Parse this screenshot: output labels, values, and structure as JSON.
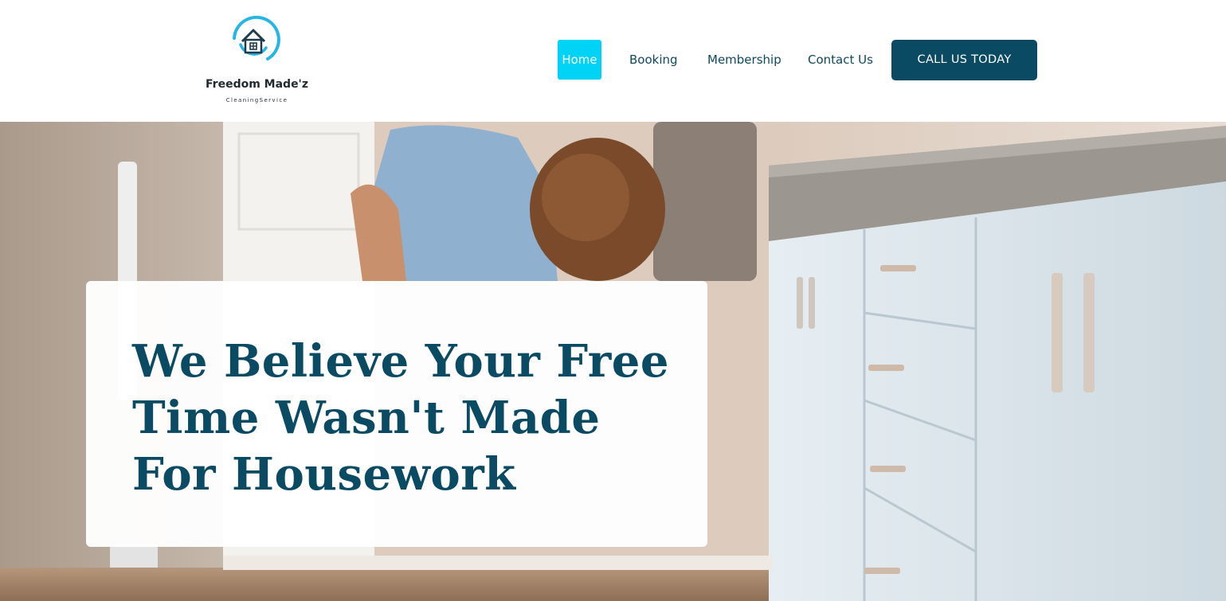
{
  "brand": {
    "name": "Freedom Made'z",
    "tagline": "CleaningService",
    "accent_color": "#25b6e6",
    "logo_icon": "house-icon"
  },
  "nav": {
    "items": [
      {
        "label": "Home",
        "active": true
      },
      {
        "label": "Booking",
        "active": false
      },
      {
        "label": "Membership",
        "active": false
      },
      {
        "label": "Contact Us",
        "active": false
      }
    ],
    "active_color": "#00d3f5",
    "cta_label": "CALL US TODAY",
    "cta_color": "#0b4a63"
  },
  "hero": {
    "headline": "We Believe Your Free Time Wasn't Made For Housework",
    "headline_color": "#0b4a63"
  }
}
